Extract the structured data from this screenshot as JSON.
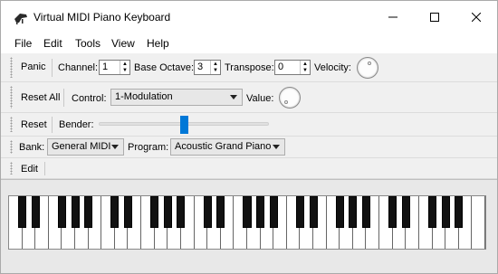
{
  "window": {
    "title": "Virtual MIDI Piano Keyboard",
    "buttons": [
      "minimize",
      "maximize",
      "close"
    ]
  },
  "menu": {
    "items": [
      "File",
      "Edit",
      "Tools",
      "View",
      "Help"
    ]
  },
  "toolbar1": {
    "panic_label": "Panic",
    "channel_label": "Channel:",
    "channel_value": "1",
    "base_octave_label": "Base Octave:",
    "base_octave_value": "3",
    "transpose_label": "Transpose:",
    "transpose_value": "0",
    "velocity_label": "Velocity:"
  },
  "toolbar2": {
    "reset_all_label": "Reset All",
    "control_label": "Control:",
    "control_value": "1-Modulation",
    "value_label": "Value:"
  },
  "toolbar3": {
    "reset_label": "Reset",
    "bender_label": "Bender:",
    "bender_position": 0.5
  },
  "toolbar4": {
    "bank_label": "Bank:",
    "bank_value": "General MIDI",
    "program_label": "Program:",
    "program_value": "Acoustic Grand Piano"
  },
  "toolbar5": {
    "edit_label": "Edit"
  },
  "piano": {
    "white_keys": 36,
    "black_pattern": [
      1,
      1,
      0,
      1,
      1,
      1,
      0
    ]
  },
  "colors": {
    "accent": "#0078d7",
    "window_bg": "#f0f0f0",
    "piano_bg": "#e8e8e8"
  }
}
